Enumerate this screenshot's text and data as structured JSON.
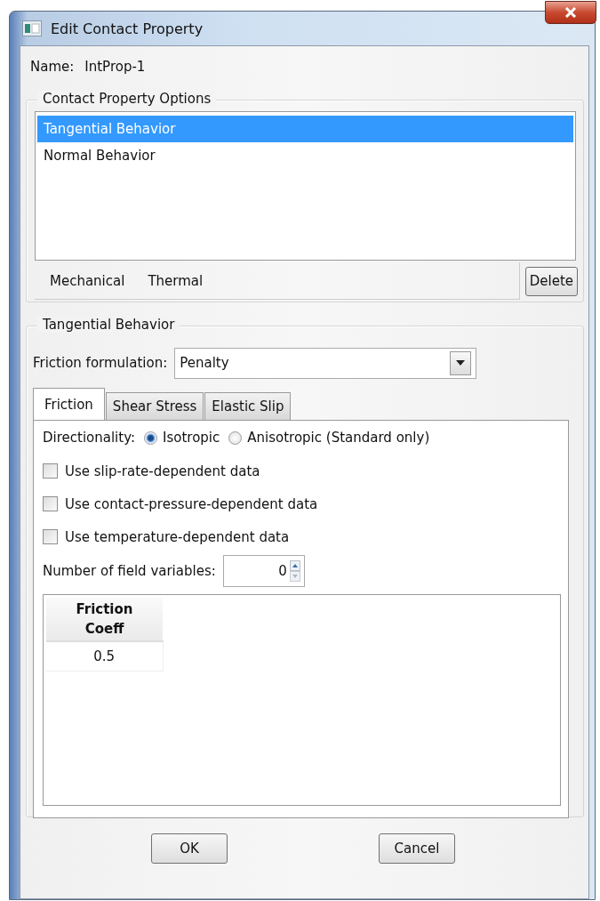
{
  "window": {
    "title": "Edit Contact Property"
  },
  "name": {
    "label": "Name:",
    "value": "IntProp-1"
  },
  "options_group": {
    "title": "Contact Property Options",
    "items": [
      {
        "label": "Tangential Behavior",
        "selected": true
      },
      {
        "label": "Normal Behavior",
        "selected": false
      }
    ],
    "menus": [
      "Mechanical",
      "Thermal"
    ],
    "delete_button": "Delete"
  },
  "behavior_group": {
    "title": "Tangential Behavior",
    "formulation": {
      "label": "Friction formulation:",
      "value": "Penalty"
    },
    "tabs": [
      {
        "label": "Friction",
        "selected": true
      },
      {
        "label": "Shear Stress",
        "selected": false
      },
      {
        "label": "Elastic Slip",
        "selected": false
      }
    ],
    "directionality": {
      "label": "Directionality:",
      "options": [
        {
          "label": "Isotropic",
          "selected": true
        },
        {
          "label": "Anisotropic (Standard only)",
          "selected": false
        }
      ]
    },
    "checkboxes": [
      {
        "label": "Use slip-rate-dependent data",
        "checked": false
      },
      {
        "label": "Use contact-pressure-dependent data",
        "checked": false
      },
      {
        "label": "Use temperature-dependent data",
        "checked": false
      }
    ],
    "field_variables": {
      "label": "Number of field variables:",
      "value": "0"
    },
    "table": {
      "columns": [
        "Friction Coeff"
      ],
      "rows": [
        [
          "0.5"
        ]
      ]
    }
  },
  "buttons": [
    "OK",
    "Cancel"
  ]
}
